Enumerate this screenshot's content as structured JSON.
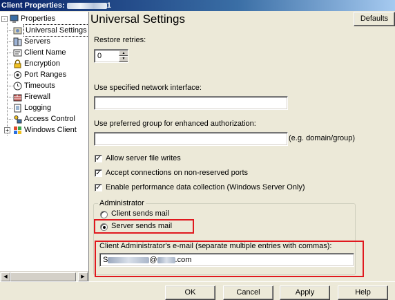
{
  "window": {
    "title_prefix": "Client Properties:",
    "title_suffix": "1"
  },
  "tree": {
    "items": [
      {
        "label": "Properties",
        "icon": "computer-icon"
      },
      {
        "label": "Universal Settings",
        "icon": "settings-gear-icon"
      },
      {
        "label": "Servers",
        "icon": "server-icon"
      },
      {
        "label": "Client Name",
        "icon": "id-card-icon"
      },
      {
        "label": "Encryption",
        "icon": "lock-icon"
      },
      {
        "label": "Port Ranges",
        "icon": "port-icon"
      },
      {
        "label": "Timeouts",
        "icon": "clock-icon"
      },
      {
        "label": "Firewall",
        "icon": "firewall-icon"
      },
      {
        "label": "Logging",
        "icon": "log-icon"
      },
      {
        "label": "Access Control",
        "icon": "access-control-icon"
      },
      {
        "label": "Windows Client",
        "icon": "windows-client-icon"
      }
    ],
    "expander_collapsed": "+",
    "expander_expanded": "-"
  },
  "main": {
    "title": "Universal Settings",
    "defaults_label": "Defaults",
    "restore_retries_label": "Restore retries:",
    "restore_retries_value": "0",
    "network_interface_label": "Use specified network interface:",
    "network_interface_value": "",
    "preferred_group_label": "Use preferred group for enhanced authorization:",
    "preferred_group_value": "",
    "preferred_group_hint": "(e.g. domain/group)",
    "checkboxes": [
      {
        "label": "Allow server file writes",
        "checked": true
      },
      {
        "label": "Accept connections on non-reserved ports",
        "checked": true
      },
      {
        "label": "Enable performance data collection (Windows Server Only)",
        "checked": true
      }
    ],
    "administrator": {
      "group_label": "Administrator",
      "client_sends_mail": "Client sends mail",
      "server_sends_mail": "Server sends mail",
      "selected": "server_sends_mail",
      "email_label": "Client Administrator's e-mail (separate multiple entries with commas):",
      "email_value_start": "S",
      "email_value_at": "@",
      "email_value_end": ".com"
    },
    "check_mark": "✓"
  },
  "footer": {
    "ok": "OK",
    "cancel": "Cancel",
    "apply": "Apply",
    "help": "Help"
  },
  "colors": {
    "highlight_box": "#e0181e",
    "title_bar": "#0a246a",
    "dialog_face": "#ece9d8"
  }
}
